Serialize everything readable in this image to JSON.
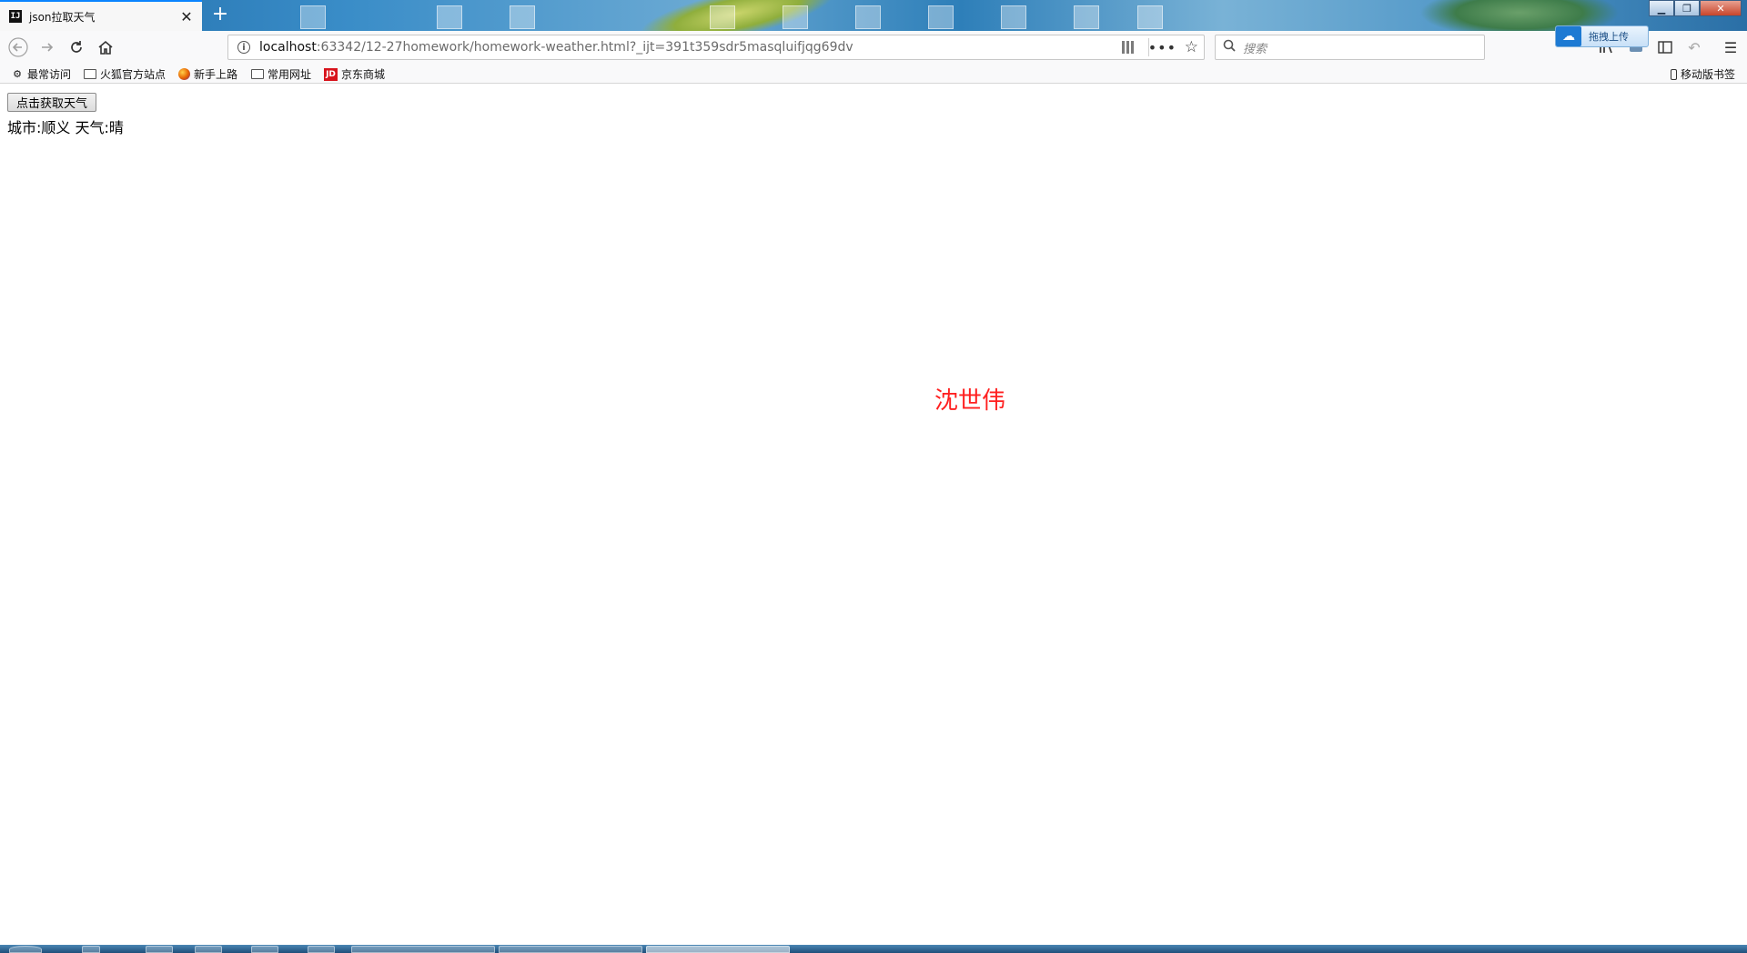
{
  "browser": {
    "tab_title": "json拉取天气",
    "tab_favicon": "IJ",
    "new_tab_symbol": "+",
    "url_host": "localhost",
    "url_path": ":63342/12-27homework/homework-weather.html?_ijt=391t359sdr5masqluifjqg69dv",
    "search_placeholder": "搜索",
    "upload_label": "拖拽上传"
  },
  "bookmarks": {
    "items": [
      {
        "label": "最常访问",
        "icon": "gear-icon"
      },
      {
        "label": "火狐官方站点",
        "icon": "folder-icon"
      },
      {
        "label": "新手上路",
        "icon": "firefox-icon"
      },
      {
        "label": "常用网址",
        "icon": "folder-icon"
      },
      {
        "label": "京东商城",
        "icon": "jd-icon"
      }
    ],
    "mobile_label": "移动版书签"
  },
  "page": {
    "button_label": "点击获取天气",
    "result_text": "城市:顺义 天气:晴",
    "author": "沈世伟"
  },
  "colors": {
    "accent": "#0a84ff",
    "author_text": "#ff2020",
    "taskbar": "#1f4f7a"
  }
}
